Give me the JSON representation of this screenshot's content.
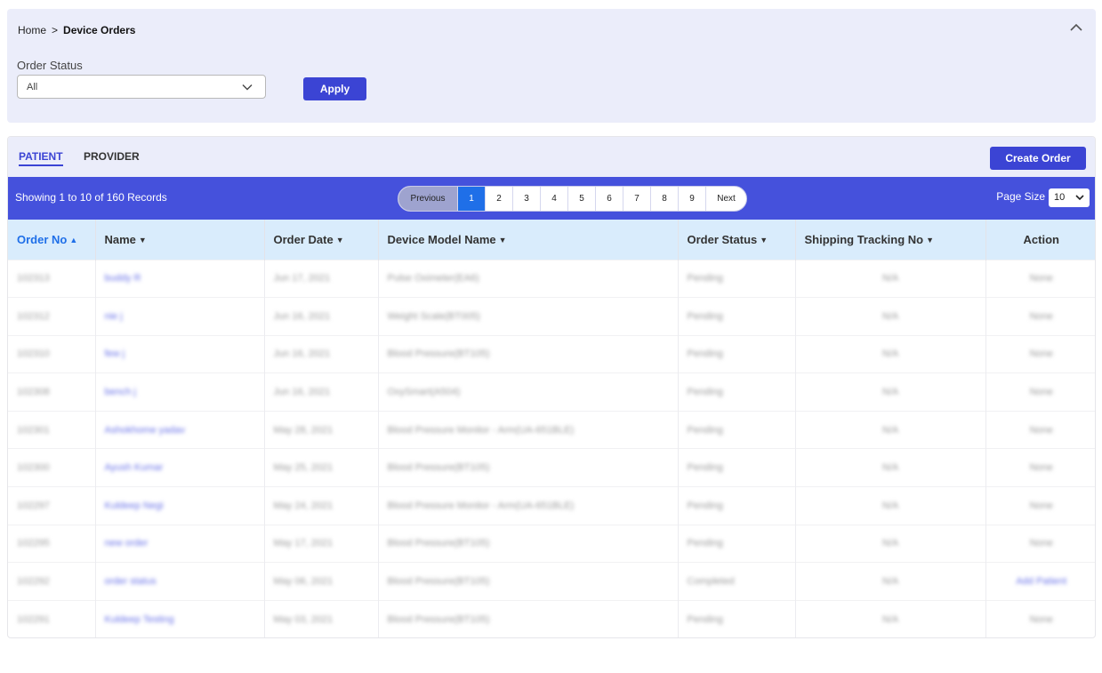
{
  "breadcrumb": {
    "home": "Home",
    "separator": ">",
    "current": "Device Orders"
  },
  "filter": {
    "status_label": "Order Status",
    "status_value": "All",
    "apply_label": "Apply"
  },
  "tabs": {
    "patient": "PATIENT",
    "provider": "PROVIDER"
  },
  "create_order_label": "Create Order",
  "records_text": "Showing 1 to 10 of 160 Records",
  "pagination": {
    "previous": "Previous",
    "pages": [
      "1",
      "2",
      "3",
      "4",
      "5",
      "6",
      "7",
      "8",
      "9"
    ],
    "active": "1",
    "next": "Next"
  },
  "page_size": {
    "label": "Page Size",
    "value": "10"
  },
  "table": {
    "headers": [
      "Order No",
      "Name",
      "Order Date",
      "Device Model Name",
      "Order Status",
      "Shipping Tracking No",
      "Action"
    ],
    "sorted_column": "Order No",
    "rows": [
      [
        "102313",
        "buddy R",
        "Jun 17, 2021",
        "Pulse Oximeter(EA6)",
        "Pending",
        "N/A",
        "None"
      ],
      [
        "102312",
        "nie j",
        "Jun 16, 2021",
        "Weight Scale(BT005)",
        "Pending",
        "N/A",
        "None"
      ],
      [
        "102310",
        "few j",
        "Jun 16, 2021",
        "Blood Pressure(BT105)",
        "Pending",
        "N/A",
        "None"
      ],
      [
        "102308",
        "bench j",
        "Jun 16, 2021",
        "OxySmart(A504)",
        "Pending",
        "N/A",
        "None"
      ],
      [
        "102301",
        "Ashokhome yadav",
        "May 28, 2021",
        "Blood Pressure Monitor - Arm(UA-651BLE)",
        "Pending",
        "N/A",
        "None"
      ],
      [
        "102300",
        "Ayush Kumar",
        "May 25, 2021",
        "Blood Pressure(BT105)",
        "Pending",
        "N/A",
        "None"
      ],
      [
        "102297",
        "Kuldeep Negi",
        "May 24, 2021",
        "Blood Pressure Monitor - Arm(UA-651BLE)",
        "Pending",
        "N/A",
        "None"
      ],
      [
        "102295",
        "new order",
        "May 17, 2021",
        "Blood Pressure(BT105)",
        "Pending",
        "N/A",
        "None"
      ],
      [
        "102292",
        "order status",
        "May 06, 2021",
        "Blood Pressure(BT105)",
        "Completed",
        "N/A",
        "Add Patient"
      ],
      [
        "102291",
        "Kuldeep Testing",
        "May 03, 2021",
        "Blood Pressure(BT105)",
        "Pending",
        "N/A",
        "None"
      ]
    ]
  },
  "colors": {
    "accent": "#3b44d4",
    "header_bar": "#4551dc",
    "active_page": "#1f6fe8",
    "panel_bg": "#ebedfa"
  }
}
